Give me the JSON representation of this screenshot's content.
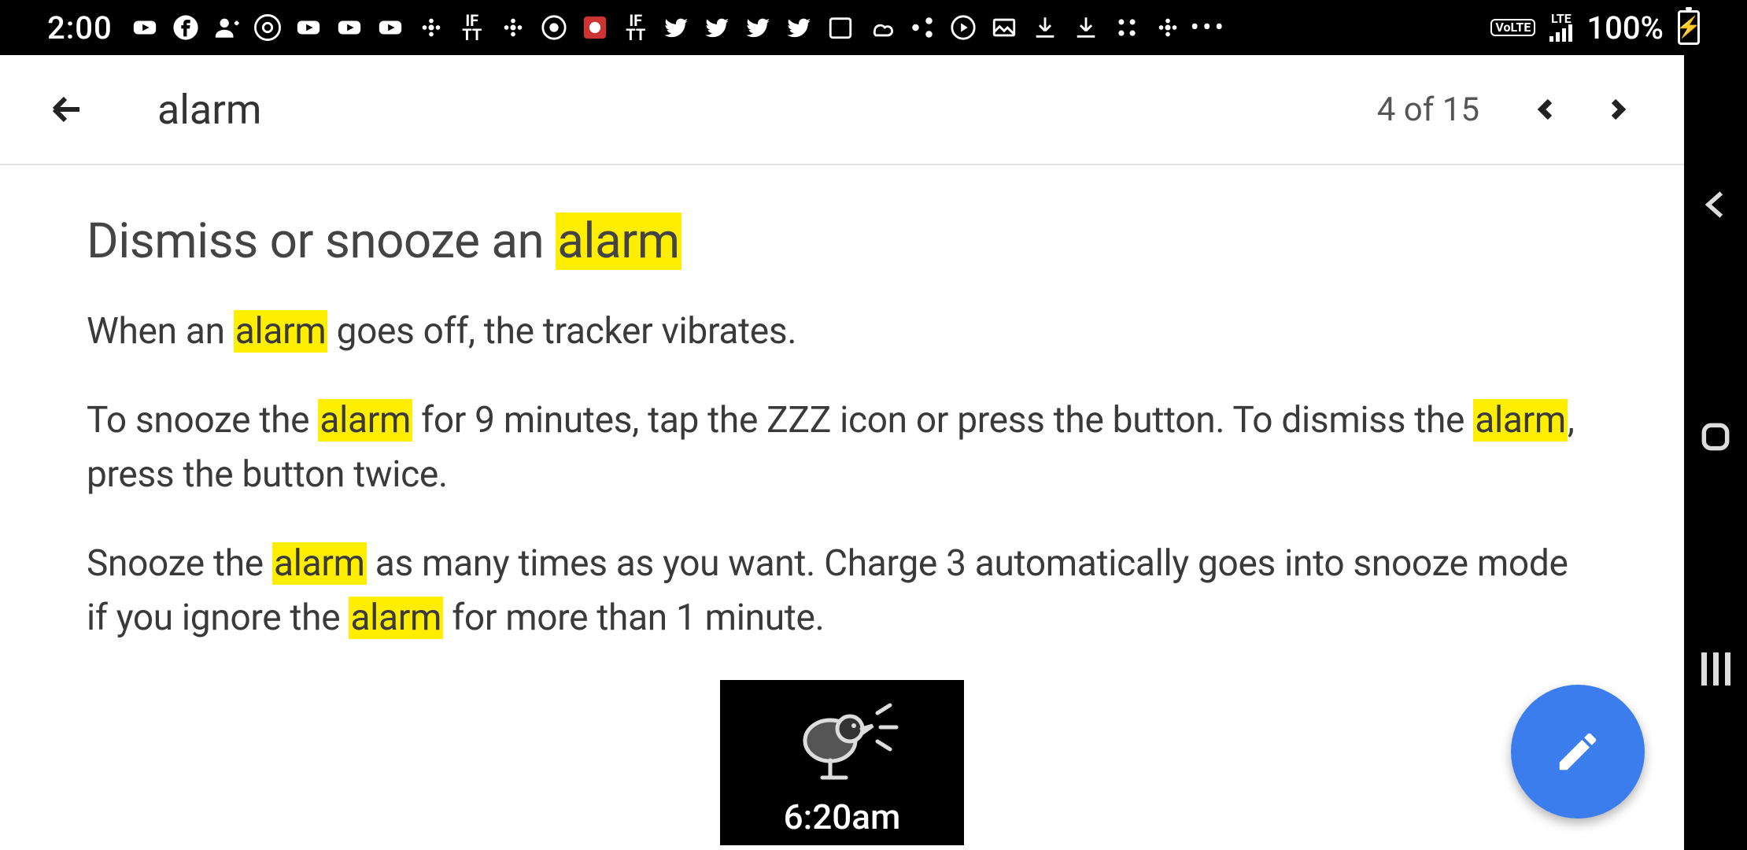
{
  "status": {
    "time": "2:00",
    "icons": [
      "youtube-icon",
      "facebook-icon",
      "person-add-icon",
      "pinterest-icon",
      "youtube-icon",
      "youtube-icon",
      "youtube-icon",
      "fitbit-icon",
      "ifttt-icon",
      "fitbit-icon",
      "chrome-icon",
      "flower-icon",
      "ifttt-icon",
      "twitter-icon",
      "twitter-icon",
      "twitter-icon",
      "twitter-icon",
      "calendar-icon",
      "weather-icon",
      "share-icon",
      "music-icon",
      "image-icon",
      "download-icon",
      "download-icon",
      "apps-icon",
      "fitbit-icon",
      "more-icon"
    ],
    "right": {
      "volte": "VoLTE",
      "net": "LTE",
      "battery_pct": "100%"
    }
  },
  "search": {
    "term": "alarm",
    "result_counter": "4 of 15"
  },
  "article": {
    "heading_pre": "Dismiss or snooze an ",
    "heading_hl": "alarm",
    "p1_a": "When an ",
    "p1_hl1": "alarm",
    "p1_b": " goes off, the tracker vibrates.",
    "p2_a": "To snooze the ",
    "p2_hl1": "alarm",
    "p2_b": " for 9 minutes, tap the ZZZ icon or press the button. To dismiss the ",
    "p2_hl2": "alarm",
    "p2_c": ", press the button twice.",
    "p3_a": "Snooze the ",
    "p3_hl1": "alarm",
    "p3_b": " as many times as you want. Charge 3 automatically goes into snooze mode if you ignore the ",
    "p3_hl2": "alarm",
    "p3_c": " for more than 1 minute."
  },
  "device": {
    "time": "6:20am"
  }
}
